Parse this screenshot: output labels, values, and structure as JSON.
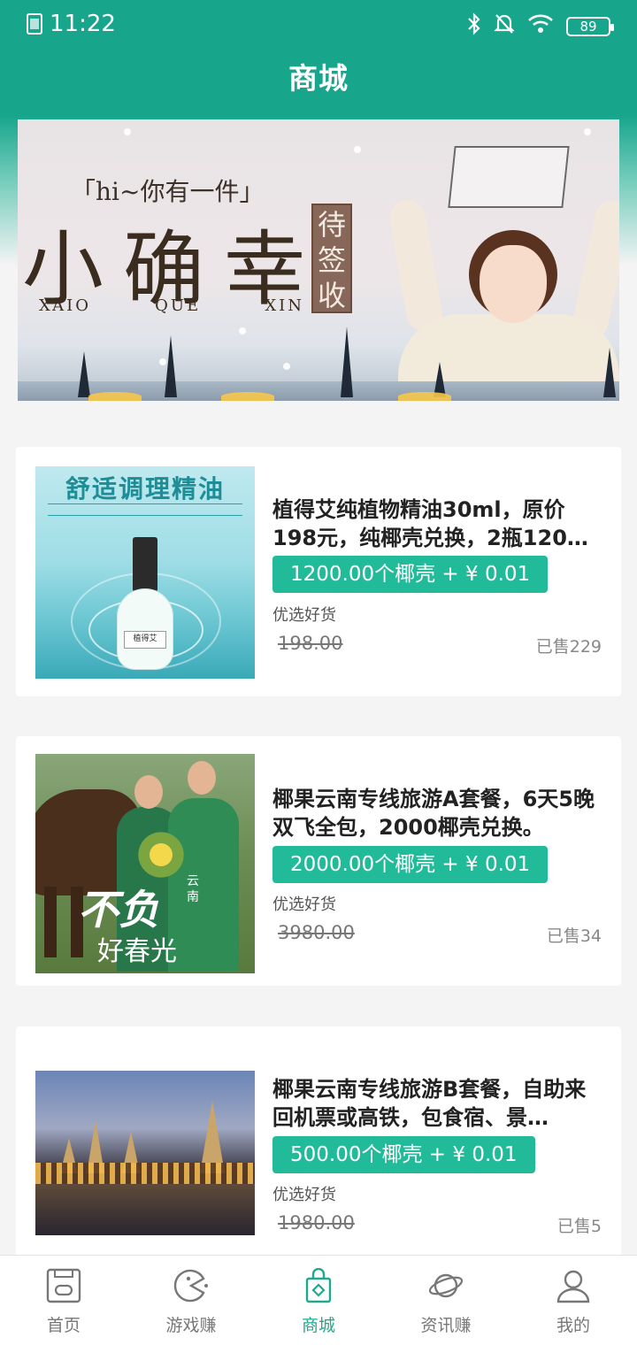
{
  "status_bar": {
    "time": "11:22",
    "battery": "89",
    "icons": [
      "sim-icon",
      "bluetooth-icon",
      "bell-muted-icon",
      "wifi-icon",
      "battery-icon"
    ]
  },
  "header": {
    "title": "商城"
  },
  "banner": {
    "tagline": "「hi~你有一件」",
    "headline": "小确幸",
    "stamp": "待签收",
    "pinyin": [
      "XAIO",
      "QUE",
      "XIN"
    ]
  },
  "products": [
    {
      "title": "植得艾纯植物精油30ml，原价198元，纯椰壳兑换，2瓶120…",
      "price": "1200.00个椰壳 + ¥ 0.01",
      "tag": "优选好货",
      "original_price": "198.00",
      "sold": "已售229",
      "image_title": "舒适调理精油",
      "image_label": "植得艾"
    },
    {
      "title": "椰果云南专线旅游A套餐，6天5晚双飞全包，2000椰壳兑换。",
      "price": "2000.00个椰壳 + ¥ 0.01",
      "tag": "优选好货",
      "original_price": "3980.00",
      "sold": "已售34",
      "image_big": "不负",
      "image_sub": "好春光",
      "image_vert": "云南"
    },
    {
      "title": "椰果云南专线旅游B套餐，自助来回机票或高铁，包食宿、景…",
      "price": "500.00个椰壳 + ¥ 0.01",
      "tag": "优选好货",
      "original_price": "1980.00",
      "sold": "已售5"
    }
  ],
  "bottom_nav": {
    "active": "商城",
    "items": [
      {
        "label": "首页",
        "icon": "home-icon"
      },
      {
        "label": "游戏赚",
        "icon": "game-icon"
      },
      {
        "label": "商城",
        "icon": "shop-bag-icon"
      },
      {
        "label": "资讯赚",
        "icon": "planet-icon"
      },
      {
        "label": "我的",
        "icon": "user-icon"
      }
    ]
  },
  "colors": {
    "brand": "#17a58c",
    "price_pill": "#21bb9a",
    "active_nav": "#1fa98f"
  }
}
